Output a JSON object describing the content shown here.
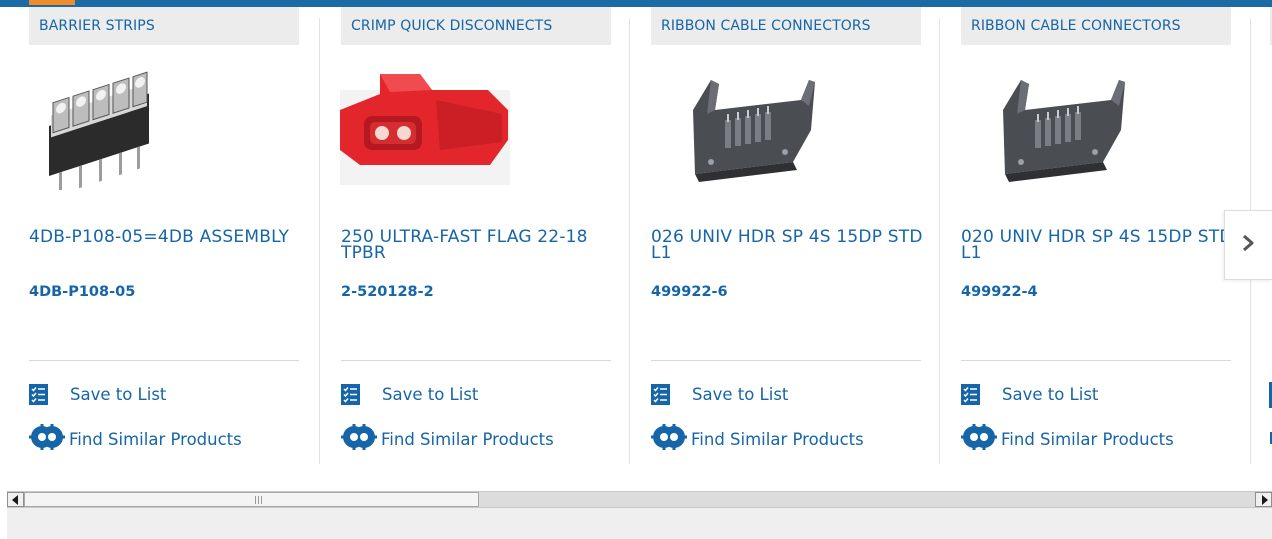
{
  "products": [
    {
      "category": "BARRIER STRIPS",
      "title": "4DB-P108-05=4DB ASSEMBLY",
      "part_number": "4DB-P108-05",
      "save_label": "Save to List",
      "find_label": "Find Similar Products",
      "image": "barrier-strip-image"
    },
    {
      "category": "CRIMP QUICK DISCONNECTS",
      "title": "250 ULTRA-FAST FLAG 22-18 TPBR",
      "part_number": "2-520128-2",
      "save_label": "Save to List",
      "find_label": "Find Similar Products",
      "image": "red-quick-disconnect-image"
    },
    {
      "category": "RIBBON CABLE CONNECTORS",
      "title": "026 UNIV HDR SP 4S 15DP STD L1",
      "part_number": "499922-6",
      "save_label": "Save to List",
      "find_label": "Find Similar Products",
      "image": "ribbon-cable-header-image"
    },
    {
      "category": "RIBBON CABLE CONNECTORS",
      "title": "020 UNIV HDR SP 4S 15DP STD L1",
      "part_number": "499922-4",
      "save_label": "Save to List",
      "find_label": "Find Similar Products",
      "image": "ribbon-cable-header-image"
    }
  ],
  "icons": {
    "save": "checklist-icon",
    "find": "find-similar-icon",
    "next": "chevron-right-icon",
    "scroll_left": "arrow-left-icon",
    "scroll_right": "arrow-right-icon"
  },
  "colors": {
    "brand_blue": "#1565a8",
    "top_bar": "#1c6aa6",
    "accent_orange": "#f28c28",
    "category_bg": "#ececec",
    "connector_red": "#e3262b"
  },
  "scroll": {
    "position_fraction": 0.0,
    "visible_fraction": 0.37
  }
}
